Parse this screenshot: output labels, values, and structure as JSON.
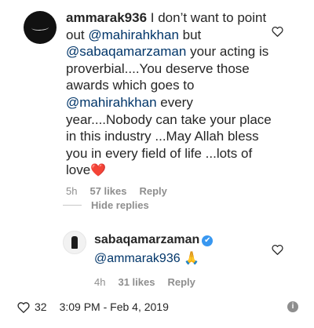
{
  "comment": {
    "username": "ammarak936",
    "text_1": " I don’t want to point out ",
    "mention_1": "@mahirahkhan",
    "text_2": " but ",
    "mention_2": "@sabaqamarzaman",
    "text_3": " your acting is proverbial....You deserve those awards which goes to ",
    "mention_3": "@mahirahkhan",
    "text_4": " every year....Nobody can take your place in this industry ...May Allah bless you in every field of life ...lots of love",
    "emoji": "❤️",
    "time": "5h",
    "likes": "57 likes",
    "reply_label": "Reply"
  },
  "hide_replies_label": "Hide replies",
  "reply": {
    "username": "sabaqamarzaman",
    "verified_mark": "✔",
    "mention": "@ammarak936",
    "emoji": "🙏",
    "time": "4h",
    "likes": "31 likes",
    "reply_label": "Reply"
  },
  "footer": {
    "like_count": "32",
    "timestamp": "3:09 PM - Feb 4, 2019",
    "info_glyph": "i"
  },
  "icons": {
    "heart_outline": "heart-icon",
    "verified": "verified-badge-icon",
    "info": "info-icon"
  },
  "colors": {
    "text": "#262626",
    "mention": "#003569",
    "muted": "#8e8e8e",
    "verified": "#3897f0"
  }
}
